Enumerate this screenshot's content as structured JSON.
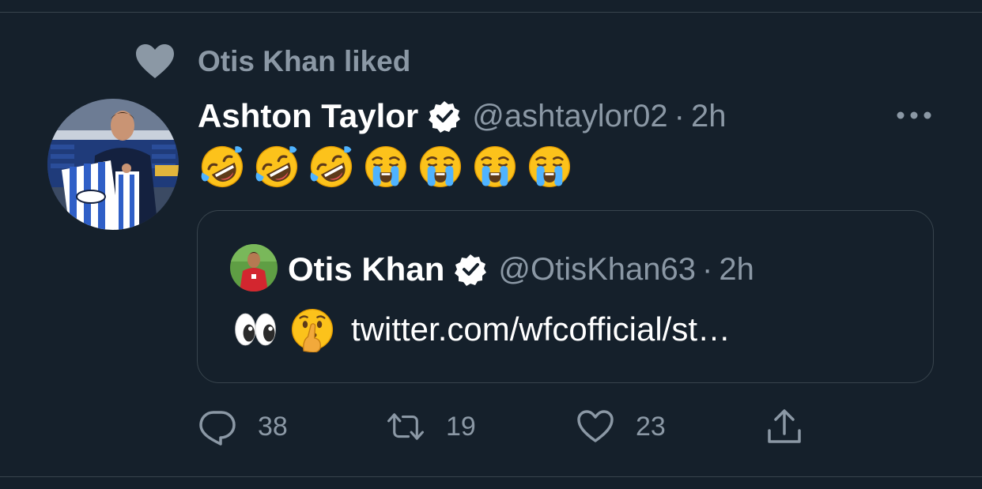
{
  "social_context": {
    "text": "Otis Khan liked",
    "icon": "heart-icon"
  },
  "tweet": {
    "display_name": "Ashton Taylor",
    "handle": "@ashtaylor02",
    "separator": "·",
    "time": "2h",
    "verified_icon": "verified-badge-icon",
    "more_icon": "more-options-icon",
    "emojis": [
      "rolling-on-floor-laughing",
      "rolling-on-floor-laughing",
      "rolling-on-floor-laughing",
      "loudly-crying",
      "loudly-crying",
      "loudly-crying",
      "loudly-crying"
    ]
  },
  "quote": {
    "display_name": "Otis Khan",
    "handle": "@OtisKhan63",
    "separator": "·",
    "time": "2h",
    "emojis": [
      "eyes",
      "shushing-face"
    ],
    "link": "twitter.com/wfcofficial/st…"
  },
  "actions": {
    "reply_count": "38",
    "retweet_count": "19",
    "like_count": "23",
    "icons": [
      "reply-icon",
      "retweet-icon",
      "like-icon",
      "share-icon"
    ]
  },
  "colors": {
    "background": "#15202b",
    "secondary_text": "#8b98a5",
    "border": "#38444d",
    "primary_text": "#ffffff"
  }
}
